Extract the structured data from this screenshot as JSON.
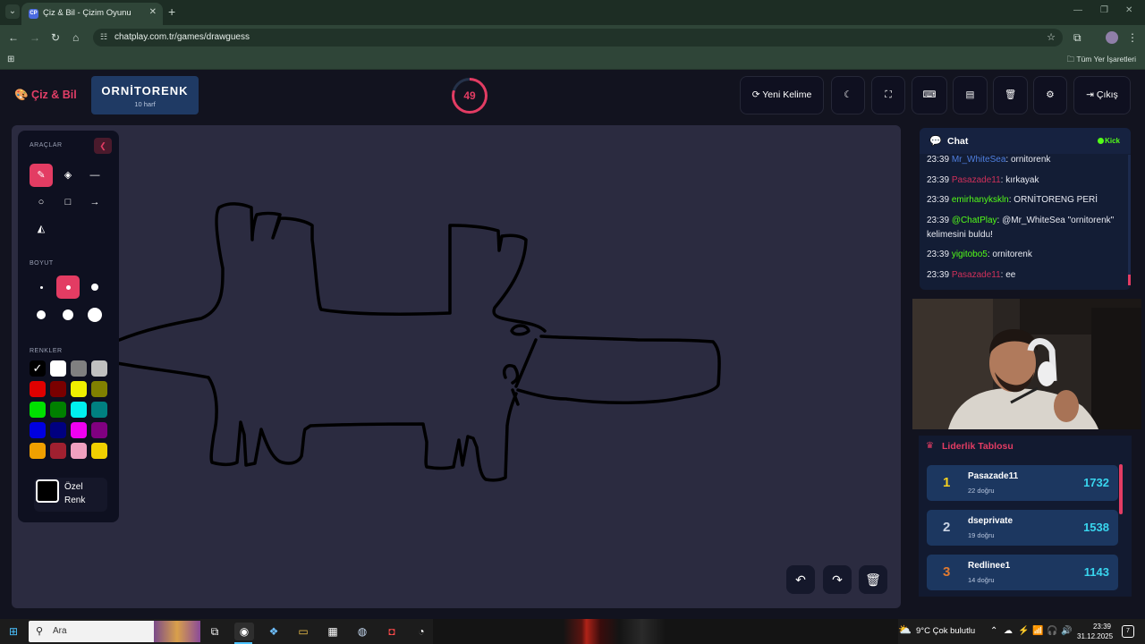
{
  "browser": {
    "tab_title": "Çiz & Bil - Çizim Oyunu",
    "tab_favicon": "CP",
    "url": "chatplay.com.tr/games/drawguess",
    "bookmarks_label": "Tüm Yer İşaretleri"
  },
  "header": {
    "logo": "Çiz & Bil",
    "word": "ORNİTORENK",
    "word_length": "10 harf",
    "timer": "49",
    "buttons": {
      "new_word": "Yeni Kelime",
      "exit": "Çıkış"
    },
    "accent": "#e33c63"
  },
  "tools": {
    "tools_label": "ARAÇLAR",
    "size_label": "BOYUT",
    "colors_label": "RENKLER",
    "custom_color_label": "Özel Renk",
    "active_tool": "pen",
    "active_size": 2,
    "icons": [
      "pen-icon",
      "eraser-icon",
      "line-icon",
      "circle-icon",
      "rectangle-icon",
      "arrow-icon",
      "fill-bucket-icon"
    ],
    "colors": [
      "#000000",
      "#ffffff",
      "#808080",
      "#c0c0c0",
      "#e00000",
      "#7a0000",
      "#f0f000",
      "#808000",
      "#00e000",
      "#008000",
      "#00f0f0",
      "#008080",
      "#0000e0",
      "#000080",
      "#f000f0",
      "#800080",
      "#f0a000",
      "#a02030",
      "#f0a0c0",
      "#f0d000"
    ],
    "selected_color": "#000000"
  },
  "chat": {
    "title": "Chat",
    "platform": "Kick",
    "messages": [
      {
        "time": "23:39",
        "user": "Mr_WhiteSea",
        "user_color": "#4f7fe0",
        "text": ": ornitorenk"
      },
      {
        "time": "23:39",
        "user": "Pasazade11",
        "user_color": "#d0305a",
        "text": ": kırkayak"
      },
      {
        "time": "23:39",
        "user": "emirhanykskln",
        "user_color": "#53fc18",
        "text": ": ORNİTORENG PERİ"
      },
      {
        "time": "23:39",
        "user": "@ChatPlay",
        "user_color": "#53fc18",
        "text": ": @Mr_WhiteSea \"ornitorenk\" kelimesini buldu!"
      },
      {
        "time": "23:39",
        "user": "yigitobo5",
        "user_color": "#53fc18",
        "text": ": ornitorenk"
      },
      {
        "time": "23:39",
        "user": "Pasazade11",
        "user_color": "#d0305a",
        "text": ": ee"
      }
    ]
  },
  "leaderboard": {
    "title": "Liderlik Tablosu",
    "rows": [
      {
        "rank": "1",
        "name": "Pasazade11",
        "correct": "22 doğru",
        "score": "1732",
        "rank_color": "#f5d020"
      },
      {
        "rank": "2",
        "name": "dseprivate",
        "correct": "19 doğru",
        "score": "1538",
        "rank_color": "#c9d3e3"
      },
      {
        "rank": "3",
        "name": "Redlinee1",
        "correct": "14 doğru",
        "score": "1143",
        "rank_color": "#e07a30"
      }
    ]
  },
  "taskbar": {
    "search_placeholder": "Ara",
    "weather": "9°C  Çok bulutlu",
    "time": "23:39",
    "date": "31.12.2025",
    "notifications": "7"
  }
}
